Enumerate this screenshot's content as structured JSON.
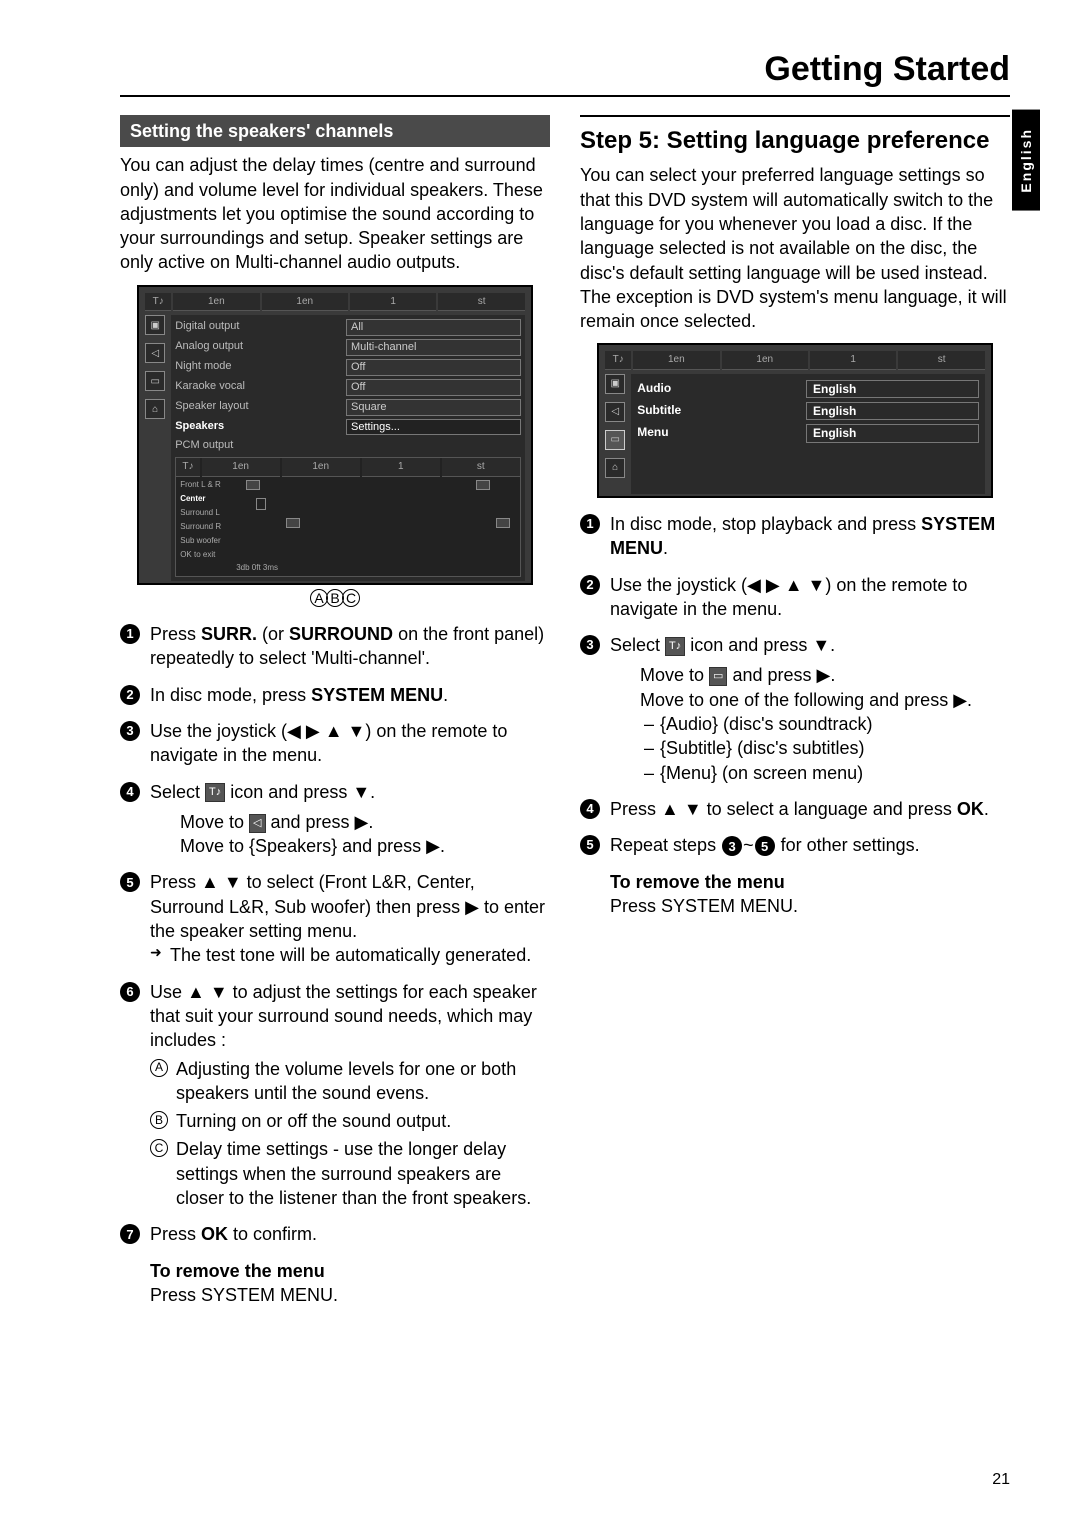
{
  "pageTitle": "Getting Started",
  "langTab": "English",
  "pageNumber": "21",
  "left": {
    "sectionBar": "Setting the speakers' channels",
    "intro": "You can adjust the delay times (centre and surround only) and volume level for individual speakers. These adjustments let you optimise the sound according to your surroundings and setup.  Speaker settings are only active on Multi-channel audio outputs.",
    "figTabs": [
      "",
      "1en",
      "1en",
      "1",
      "st"
    ],
    "figRows": [
      {
        "label": "Digital output",
        "val": "All"
      },
      {
        "label": "Analog output",
        "val": "Multi-channel"
      },
      {
        "label": "Night mode",
        "val": "Off"
      },
      {
        "label": "Karaoke vocal",
        "val": "Off"
      },
      {
        "label": "Speaker layout",
        "val": "Square"
      },
      {
        "label": "Speakers",
        "hl": true,
        "val": "Settings..."
      },
      {
        "label": "PCM output",
        "val": ""
      }
    ],
    "figSpeakerLabels": {
      "frontLR": "Front L & R",
      "center": "Center",
      "surroundL": "Surround L",
      "surroundR": "Surround R",
      "sub": "Sub woofer",
      "ok": "OK to exit",
      "bottom": "3db   0ft   3ms"
    },
    "abc": [
      "A",
      "B",
      "C"
    ],
    "steps": {
      "s1a": "Press ",
      "s1b": "SURR.",
      "s1c": " (or ",
      "s1d": "SURROUND",
      "s1e": " on the front panel) repeatedly to select 'Multi-channel'.",
      "s2a": "In disc mode, press ",
      "s2b": "SYSTEM MENU",
      "s2c": ".",
      "s3": "Use the joystick (◀ ▶ ▲ ▼) on the remote to navigate in the menu.",
      "s4a": "Select ",
      "s4b": " icon and press ▼.",
      "s4sub1a": "Move to ",
      "s4sub1b": " and press ▶.",
      "s4sub2": "Move to {Speakers} and press ▶.",
      "s5a": "Press ▲ ▼ to select (Front L&R, Center, Surround L&R, Sub woofer) then press ▶ to enter the speaker setting menu.",
      "s5arrow": "The test tone will be automatically generated.",
      "s6": "Use ▲ ▼ to adjust the settings for each speaker that suit your surround sound needs, which may includes :",
      "s6a": "Adjusting the volume levels for one or both speakers until the sound evens.",
      "s6b": "Turning on or off the sound output.",
      "s6c": "Delay time settings - use the longer delay settings when the surround speakers are closer to the listener than the front speakers.",
      "s7a": "Press ",
      "s7b": "OK",
      "s7c": " to confirm."
    },
    "removeTitle": "To remove the menu",
    "removeBody": "Press SYSTEM MENU."
  },
  "right": {
    "stepTitle": "Step 5:  Setting language preference",
    "intro": "You can select your preferred language settings so that this DVD system will automatically switch to the language for you whenever you load a disc.  If the language selected is not available on the disc, the disc's default setting language will be used instead.  The exception is DVD system's menu language, it will remain once selected.",
    "figTabs": [
      "",
      "1en",
      "1en",
      "1",
      "st"
    ],
    "figRows": [
      {
        "l": "Audio",
        "r": "English"
      },
      {
        "l": "Subtitle",
        "r": "English"
      },
      {
        "l": "Menu",
        "r": "English"
      }
    ],
    "steps": {
      "s1a": "In disc mode, stop playback and press ",
      "s1b": "SYSTEM MENU",
      "s1c": ".",
      "s2": "Use the joystick (◀ ▶ ▲ ▼) on the remote to navigate in the menu.",
      "s3a": "Select ",
      "s3b": " icon and press ▼.",
      "s3sub1a": "Move to ",
      "s3sub1b": " and press ▶.",
      "s3sub2": "Move to one of the following and press ▶.",
      "s3list": [
        "{Audio} (disc's soundtrack)",
        "{Subtitle} (disc's subtitles)",
        "{Menu} (on screen menu)"
      ],
      "s4a": "Press ▲ ▼ to select a language and press ",
      "s4b": "OK",
      "s4c": ".",
      "s5a": "Repeat steps ",
      "s5b": "~",
      "s5c": " for other settings."
    },
    "removeTitle": "To remove the menu",
    "removeBody": "Press SYSTEM MENU."
  }
}
